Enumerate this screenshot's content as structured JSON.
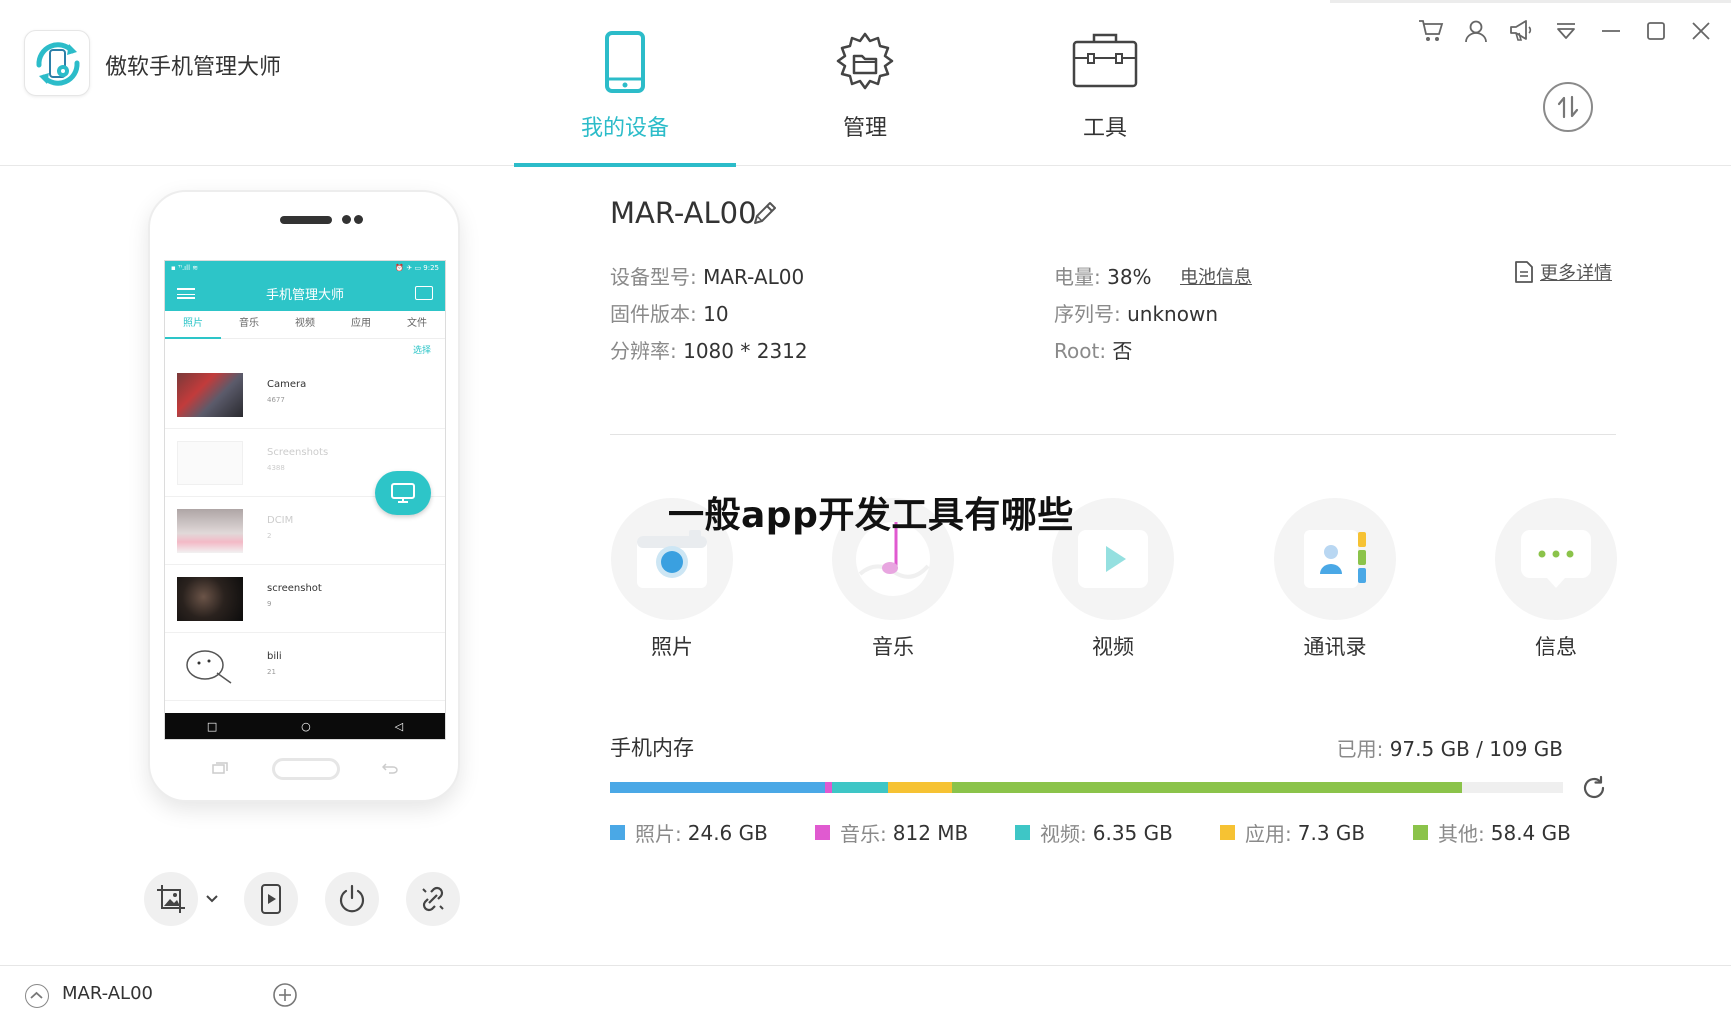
{
  "app": {
    "title": "傲软手机管理大师",
    "logo_icon": "phone-sync-gear-icon"
  },
  "nav": {
    "tabs": [
      {
        "label": "我的设备",
        "icon": "smartphone-icon",
        "active": true
      },
      {
        "label": "管理",
        "icon": "folder-gear-icon",
        "active": false
      },
      {
        "label": "工具",
        "icon": "toolbox-icon",
        "active": false
      }
    ]
  },
  "window_controls": [
    "cart-icon",
    "user-icon",
    "megaphone-icon",
    "dropdown-menu-icon",
    "minimize-icon",
    "maximize-icon",
    "close-icon"
  ],
  "phone": {
    "screen_status_left": "▪ ᵀᴵ.ıll ≋",
    "screen_status_right": "⏰ ✈ ▭ 9:25",
    "screen_title": "手机管理大师",
    "screen_tabs": [
      "照片",
      "音乐",
      "视频",
      "应用",
      "文件"
    ],
    "screen_select": "选择",
    "albums": [
      {
        "name": "Camera",
        "count": "4677"
      },
      {
        "name": "Screenshots",
        "count": "4388"
      },
      {
        "name": "DCIM",
        "count": "2"
      },
      {
        "name": "screenshot",
        "count": "9"
      },
      {
        "name": "bili",
        "count": "21"
      }
    ],
    "tools": [
      "screenshot-crop-icon",
      "screen-record-icon",
      "power-icon",
      "disconnect-link-icon"
    ]
  },
  "device": {
    "name": "MAR-AL00",
    "model_label": "设备型号:",
    "model": "MAR-AL00",
    "firmware_label": "固件版本:",
    "firmware": "10",
    "resolution_label": "分辨率:",
    "resolution": "1080 * 2312",
    "battery_label": "电量:",
    "battery": "38%",
    "battery_link": "电池信息",
    "serial_label": "序列号:",
    "serial": "unknown",
    "root_label": "Root:",
    "root": "否",
    "more_details": "更多详情"
  },
  "overlay_title": "一般app开发工具有哪些",
  "categories": [
    {
      "label": "照片",
      "icon": "camera-icon"
    },
    {
      "label": "音乐",
      "icon": "music-note-icon"
    },
    {
      "label": "视频",
      "icon": "video-play-icon"
    },
    {
      "label": "通讯录",
      "icon": "contacts-icon"
    },
    {
      "label": "信息",
      "icon": "message-bubble-icon"
    }
  ],
  "storage": {
    "title": "手机内存",
    "used_label": "已用:",
    "used_value": "97.5 GB / 109 GB",
    "total_gb": 109,
    "segments": [
      {
        "label": "照片:",
        "value": "24.6 GB",
        "gb": 24.6,
        "color": "#4aa8e6"
      },
      {
        "label": "音乐:",
        "value": "812 MB",
        "gb": 0.812,
        "color": "#e05ad0"
      },
      {
        "label": "视频:",
        "value": "6.35 GB",
        "gb": 6.35,
        "color": "#3ec6c6"
      },
      {
        "label": "应用:",
        "value": "7.3 GB",
        "gb": 7.3,
        "color": "#f6c233"
      },
      {
        "label": "其他:",
        "value": "58.4 GB",
        "gb": 58.4,
        "color": "#8bc34a"
      }
    ]
  },
  "footer": {
    "device": "MAR-AL00"
  },
  "colors": {
    "accent": "#2cbcc9"
  }
}
